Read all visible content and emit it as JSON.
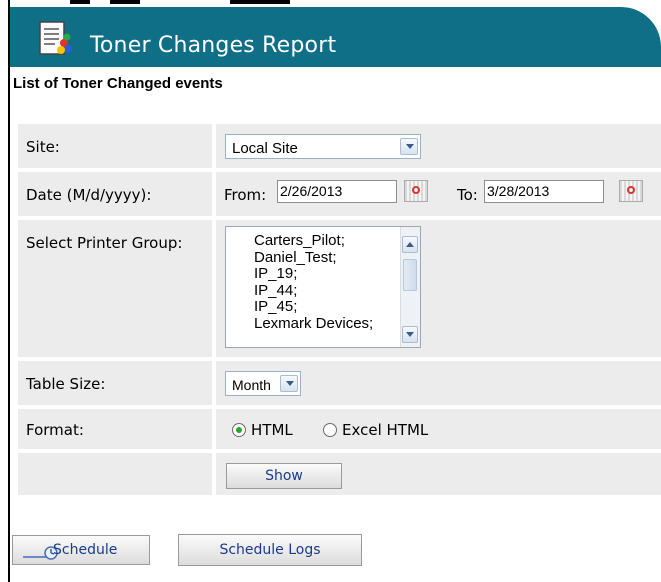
{
  "header": {
    "title": "Toner Changes Report",
    "icon": "report-document-icon"
  },
  "subtitle": "List of Toner Changed events",
  "form": {
    "site": {
      "label": "Site:",
      "value": "Local Site"
    },
    "date": {
      "label": "Date (M/d/yyyy):",
      "from_label": "From:",
      "from_value": "2/26/2013",
      "to_label": "To:",
      "to_value": "3/28/2013"
    },
    "printer_group": {
      "label": "Select Printer Group:",
      "items": [
        "Carters_Pilot;",
        "Daniel_Test;",
        "IP_19;",
        "IP_44;",
        "IP_45;",
        "Lexmark Devices;"
      ]
    },
    "table_size": {
      "label": "Table Size:",
      "value": "Month"
    },
    "format": {
      "label": "Format:",
      "options": [
        "HTML",
        "Excel HTML"
      ],
      "selected": "HTML"
    },
    "show_label": "Show"
  },
  "footer": {
    "schedule_label": "Schedule",
    "schedule_logs_label": "Schedule Logs"
  },
  "colors": {
    "header_bg": "#0f6f86",
    "row_bg": "#ececec",
    "radio_selected": "#2ea52e"
  }
}
